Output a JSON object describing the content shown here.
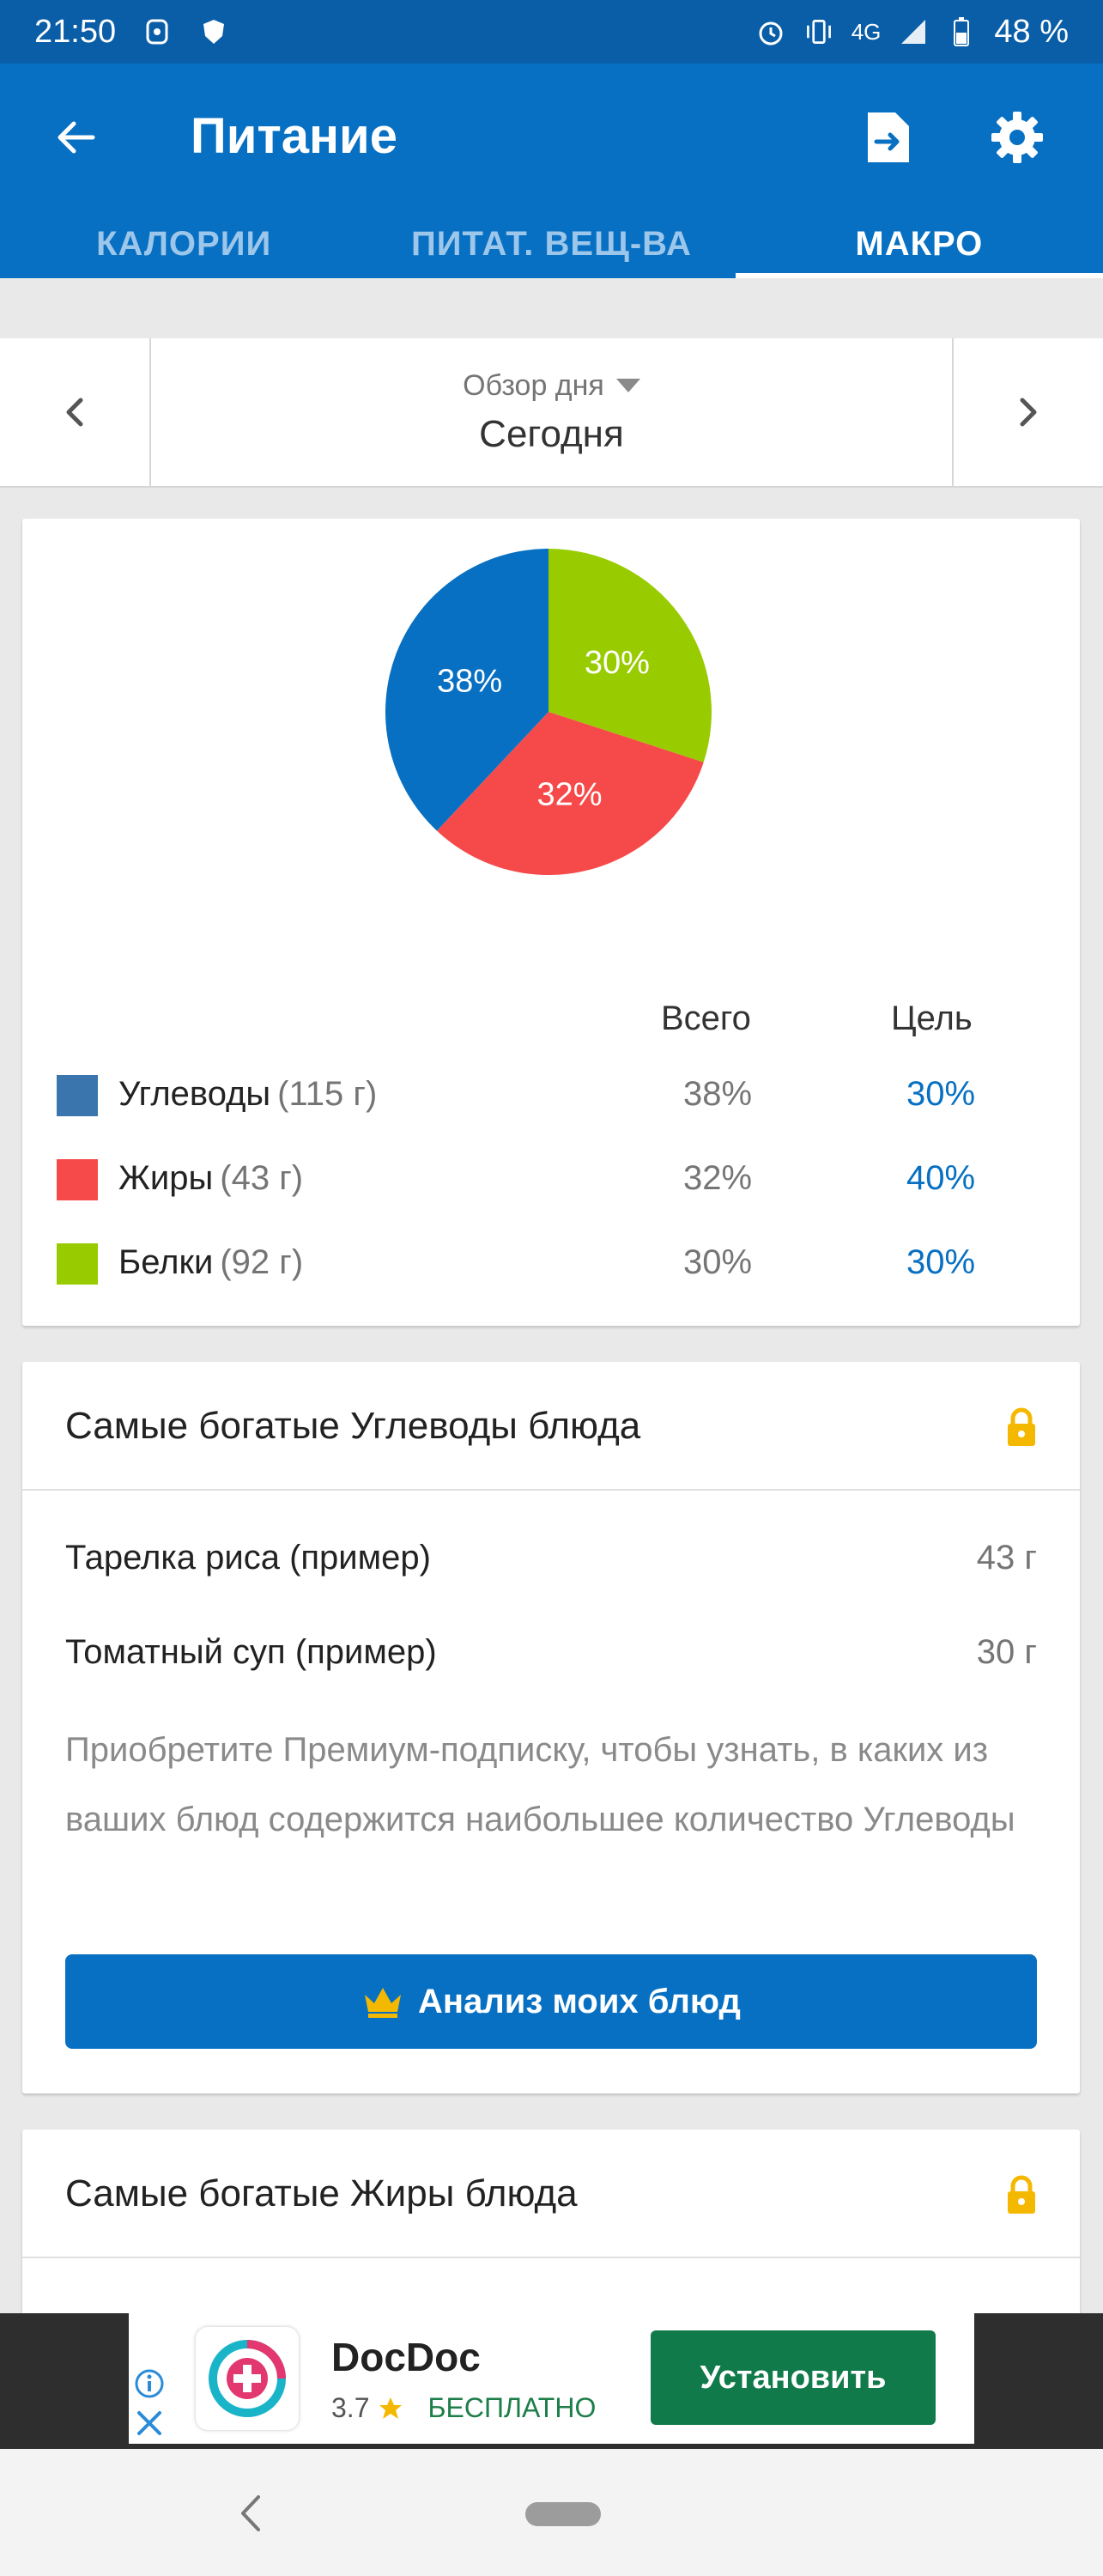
{
  "status_bar": {
    "time": "21:50",
    "network": "4G",
    "battery": "48 %"
  },
  "app_bar": {
    "title": "Питание",
    "back_icon": "arrow-left-icon",
    "export_icon": "file-export-icon",
    "settings_icon": "gear-icon",
    "color": "#0770c2"
  },
  "tabs": [
    {
      "label": "КАЛОРИИ",
      "active": false
    },
    {
      "label": "ПИТАТ. ВЕЩ-ВА",
      "active": false
    },
    {
      "label": "МАКРО",
      "active": true
    }
  ],
  "day_nav": {
    "mode": "Обзор дня",
    "value": "Сегодня"
  },
  "macro_card": {
    "header_total": "Всего",
    "header_goal": "Цель",
    "rows": [
      {
        "name": "Углеводы",
        "amount": "(115 г)",
        "total": "38%",
        "goal": "30%",
        "color": "#3a75ad"
      },
      {
        "name": "Жиры",
        "amount": "(43 г)",
        "total": "32%",
        "goal": "40%",
        "color": "#f64a4a"
      },
      {
        "name": "Белки",
        "amount": "(92 г)",
        "total": "30%",
        "goal": "30%",
        "color": "#99cc00"
      }
    ]
  },
  "chart_data": {
    "type": "pie",
    "categories": [
      "Углеводы",
      "Жиры",
      "Белки"
    ],
    "values": [
      38,
      32,
      30
    ],
    "labels": [
      "38%",
      "32%",
      "30%"
    ],
    "colors": [
      "#0770c2",
      "#f64a4a",
      "#99cc00"
    ]
  },
  "carbs_card": {
    "title": "Самые богатые Углеводы блюда",
    "foods": [
      {
        "name": "Тарелка риса (пример)",
        "qty": "43 г"
      },
      {
        "name": "Томатный суп (пример)",
        "qty": "30 г"
      }
    ],
    "premium_text": "Приобретите Премиум-подписку, чтобы узнать, в каких из ваших блюд содержится наибольшее количество Углеводы",
    "cta_label": "Анализ моих блюд"
  },
  "fats_card": {
    "title": "Самые богатые Жиры блюда"
  },
  "ad": {
    "title": "DocDoc",
    "rating": "3.7",
    "price": "БЕСПЛАТНО",
    "install_label": "Установить"
  }
}
